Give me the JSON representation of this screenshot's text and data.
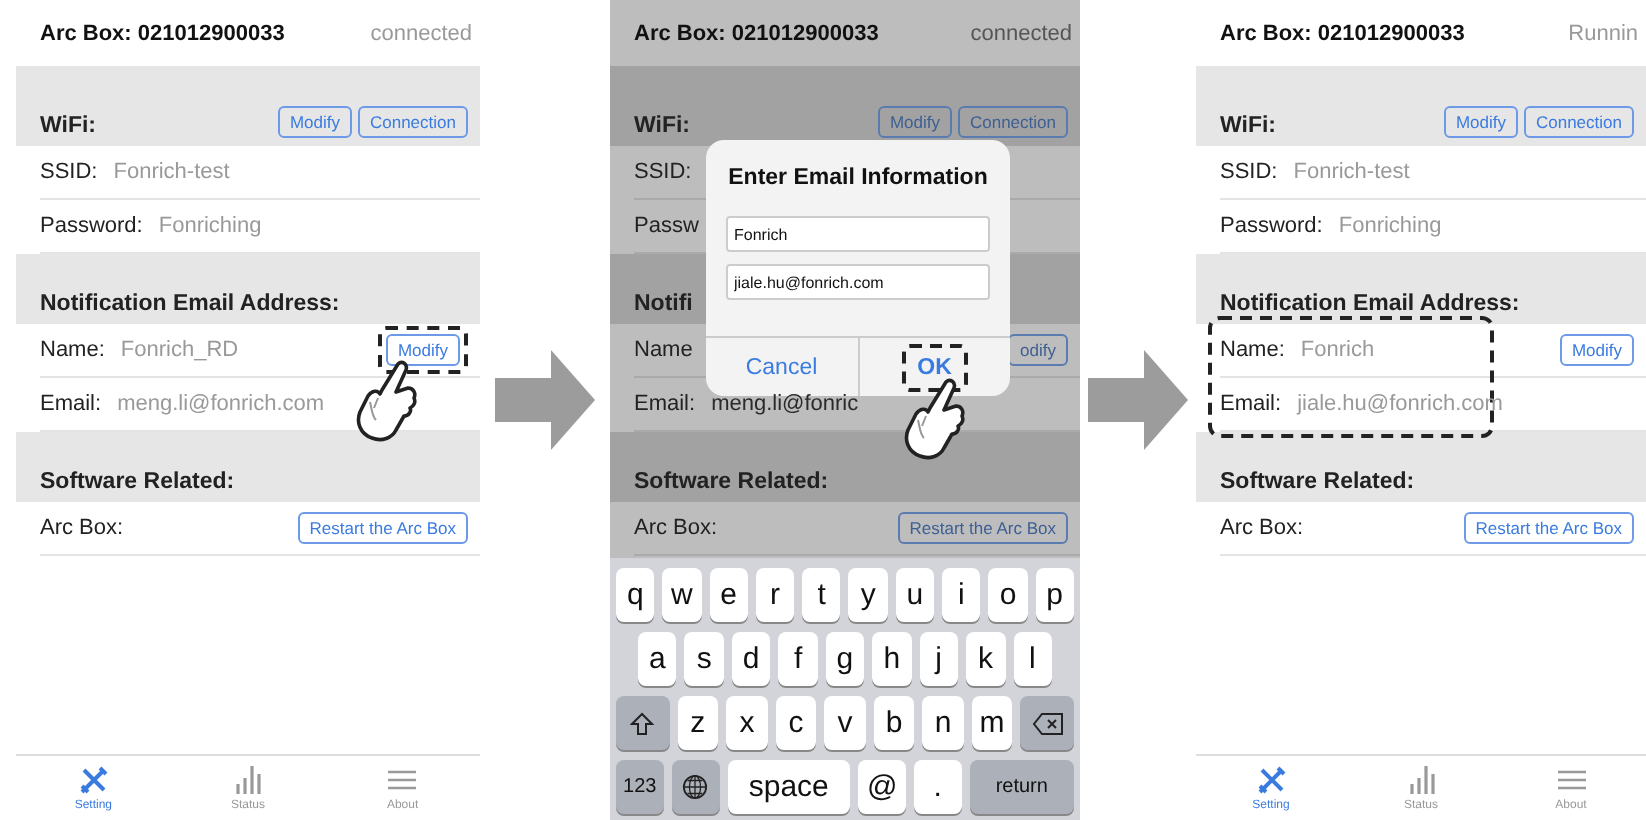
{
  "screens": [
    {
      "kind": "settings",
      "dimmed": false,
      "header": {
        "title": "Arc Box: 021012900033",
        "status": "connected"
      },
      "sections": [
        {
          "title": "WiFi:",
          "highlighted": false,
          "buttons": [
            {
              "label": "Modify",
              "highlighted": false
            },
            {
              "label": "Connection",
              "highlighted": false
            }
          ],
          "rows": [
            {
              "label": "SSID:",
              "value": "Fonrich-test"
            },
            {
              "label": "Password:",
              "value": "Fonriching"
            }
          ]
        },
        {
          "title": "Notification Email Address:",
          "highlighted": false,
          "rows": [
            {
              "label": "Name:",
              "value": "Fonrich_RD",
              "button": {
                "label": "Modify",
                "highlighted": true
              }
            },
            {
              "label": "Email:",
              "value": "meng.li@fonrich.com"
            }
          ]
        },
        {
          "title": "Software Related:",
          "highlighted": false,
          "rows": [
            {
              "label": "Arc Box:",
              "button": {
                "label": "Restart the Arc Box",
                "highlighted": false
              }
            }
          ]
        }
      ],
      "tab_bar": [
        {
          "label": "Setting",
          "selected": true
        },
        {
          "label": "Status",
          "selected": false
        },
        {
          "label": "About",
          "selected": false
        }
      ]
    },
    {
      "kind": "dialog",
      "dimmed": true,
      "header": {
        "title": "Arc Box: 021012900033",
        "status": "connected"
      },
      "sections": [
        {
          "title": "WiFi:",
          "highlighted": false,
          "buttons": [
            {
              "label": "Modify",
              "highlighted": false
            },
            {
              "label": "Connection",
              "highlighted": false
            }
          ],
          "rows": [
            {
              "label": "SSID:"
            },
            {
              "label": "Passw"
            }
          ]
        },
        {
          "title": "Notifi",
          "highlighted": false,
          "rows": [
            {
              "label": "Name",
              "button": {
                "label": "odify",
                "highlighted": false
              }
            },
            {
              "label": "Email:",
              "value": "meng.li@fonric"
            }
          ]
        },
        {
          "title": "Software Related:",
          "highlighted": false,
          "rows": [
            {
              "label": "Arc Box:",
              "button": {
                "label": "Restart the Arc Box",
                "highlighted": false
              }
            }
          ]
        }
      ],
      "dialog": {
        "title": "Enter Email Information",
        "fields": [
          {
            "value": "Fonrich"
          },
          {
            "value": "jiale.hu@fonrich.com"
          }
        ],
        "buttons": [
          {
            "label": "Cancel",
            "highlighted": false
          },
          {
            "label": "OK",
            "highlighted": true
          }
        ]
      },
      "keyboard": [
        [
          {
            "kind": "letter",
            "label": "q"
          },
          {
            "kind": "letter",
            "label": "w"
          },
          {
            "kind": "letter",
            "label": "e"
          },
          {
            "kind": "letter",
            "label": "r"
          },
          {
            "kind": "letter",
            "label": "t"
          },
          {
            "kind": "letter",
            "label": "y"
          },
          {
            "kind": "letter",
            "label": "u"
          },
          {
            "kind": "letter",
            "label": "i"
          },
          {
            "kind": "letter",
            "label": "o"
          },
          {
            "kind": "letter",
            "label": "p"
          }
        ],
        [
          {
            "kind": "letter",
            "label": "a"
          },
          {
            "kind": "letter",
            "label": "s"
          },
          {
            "kind": "letter",
            "label": "d"
          },
          {
            "kind": "letter",
            "label": "f"
          },
          {
            "kind": "letter",
            "label": "g"
          },
          {
            "kind": "letter",
            "label": "h"
          },
          {
            "kind": "letter",
            "label": "j"
          },
          {
            "kind": "letter",
            "label": "k"
          },
          {
            "kind": "letter",
            "label": "l"
          }
        ],
        [
          {
            "kind": "shift"
          },
          {
            "kind": "letter",
            "label": "z"
          },
          {
            "kind": "letter",
            "label": "x"
          },
          {
            "kind": "letter",
            "label": "c"
          },
          {
            "kind": "letter",
            "label": "v"
          },
          {
            "kind": "letter",
            "label": "b"
          },
          {
            "kind": "letter",
            "label": "n"
          },
          {
            "kind": "letter",
            "label": "m"
          },
          {
            "kind": "backspace"
          }
        ],
        [
          {
            "kind": "function",
            "label": "123"
          },
          {
            "kind": "globe"
          },
          {
            "kind": "space",
            "label": "space"
          },
          {
            "kind": "letter",
            "label": "@"
          },
          {
            "kind": "letter",
            "label": "."
          },
          {
            "kind": "return",
            "label": "return"
          }
        ]
      ]
    },
    {
      "kind": "settings",
      "dimmed": false,
      "header": {
        "title": "Arc Box: 021012900033",
        "status": "Runnin"
      },
      "sections": [
        {
          "title": "WiFi:",
          "highlighted": false,
          "buttons": [
            {
              "label": "Modify",
              "highlighted": false
            },
            {
              "label": "Connection",
              "highlighted": false
            }
          ],
          "rows": [
            {
              "label": "SSID:",
              "value": "Fonrich-test"
            },
            {
              "label": "Password:",
              "value": "Fonriching"
            }
          ]
        },
        {
          "title": "Notification Email Address:",
          "highlighted": true,
          "rows": [
            {
              "label": "Name:",
              "value": "Fonrich",
              "button": {
                "label": "Modify",
                "highlighted": false
              }
            },
            {
              "label": "Email:",
              "value": "jiale.hu@fonrich.com"
            }
          ]
        },
        {
          "title": "Software Related:",
          "highlighted": false,
          "rows": [
            {
              "label": "Arc Box:",
              "button": {
                "label": "Restart the Arc Box",
                "highlighted": false
              }
            }
          ]
        }
      ],
      "tab_bar": [
        {
          "label": "Setting",
          "selected": true
        },
        {
          "label": "Status",
          "selected": false
        },
        {
          "label": "About",
          "selected": false
        }
      ]
    }
  ]
}
